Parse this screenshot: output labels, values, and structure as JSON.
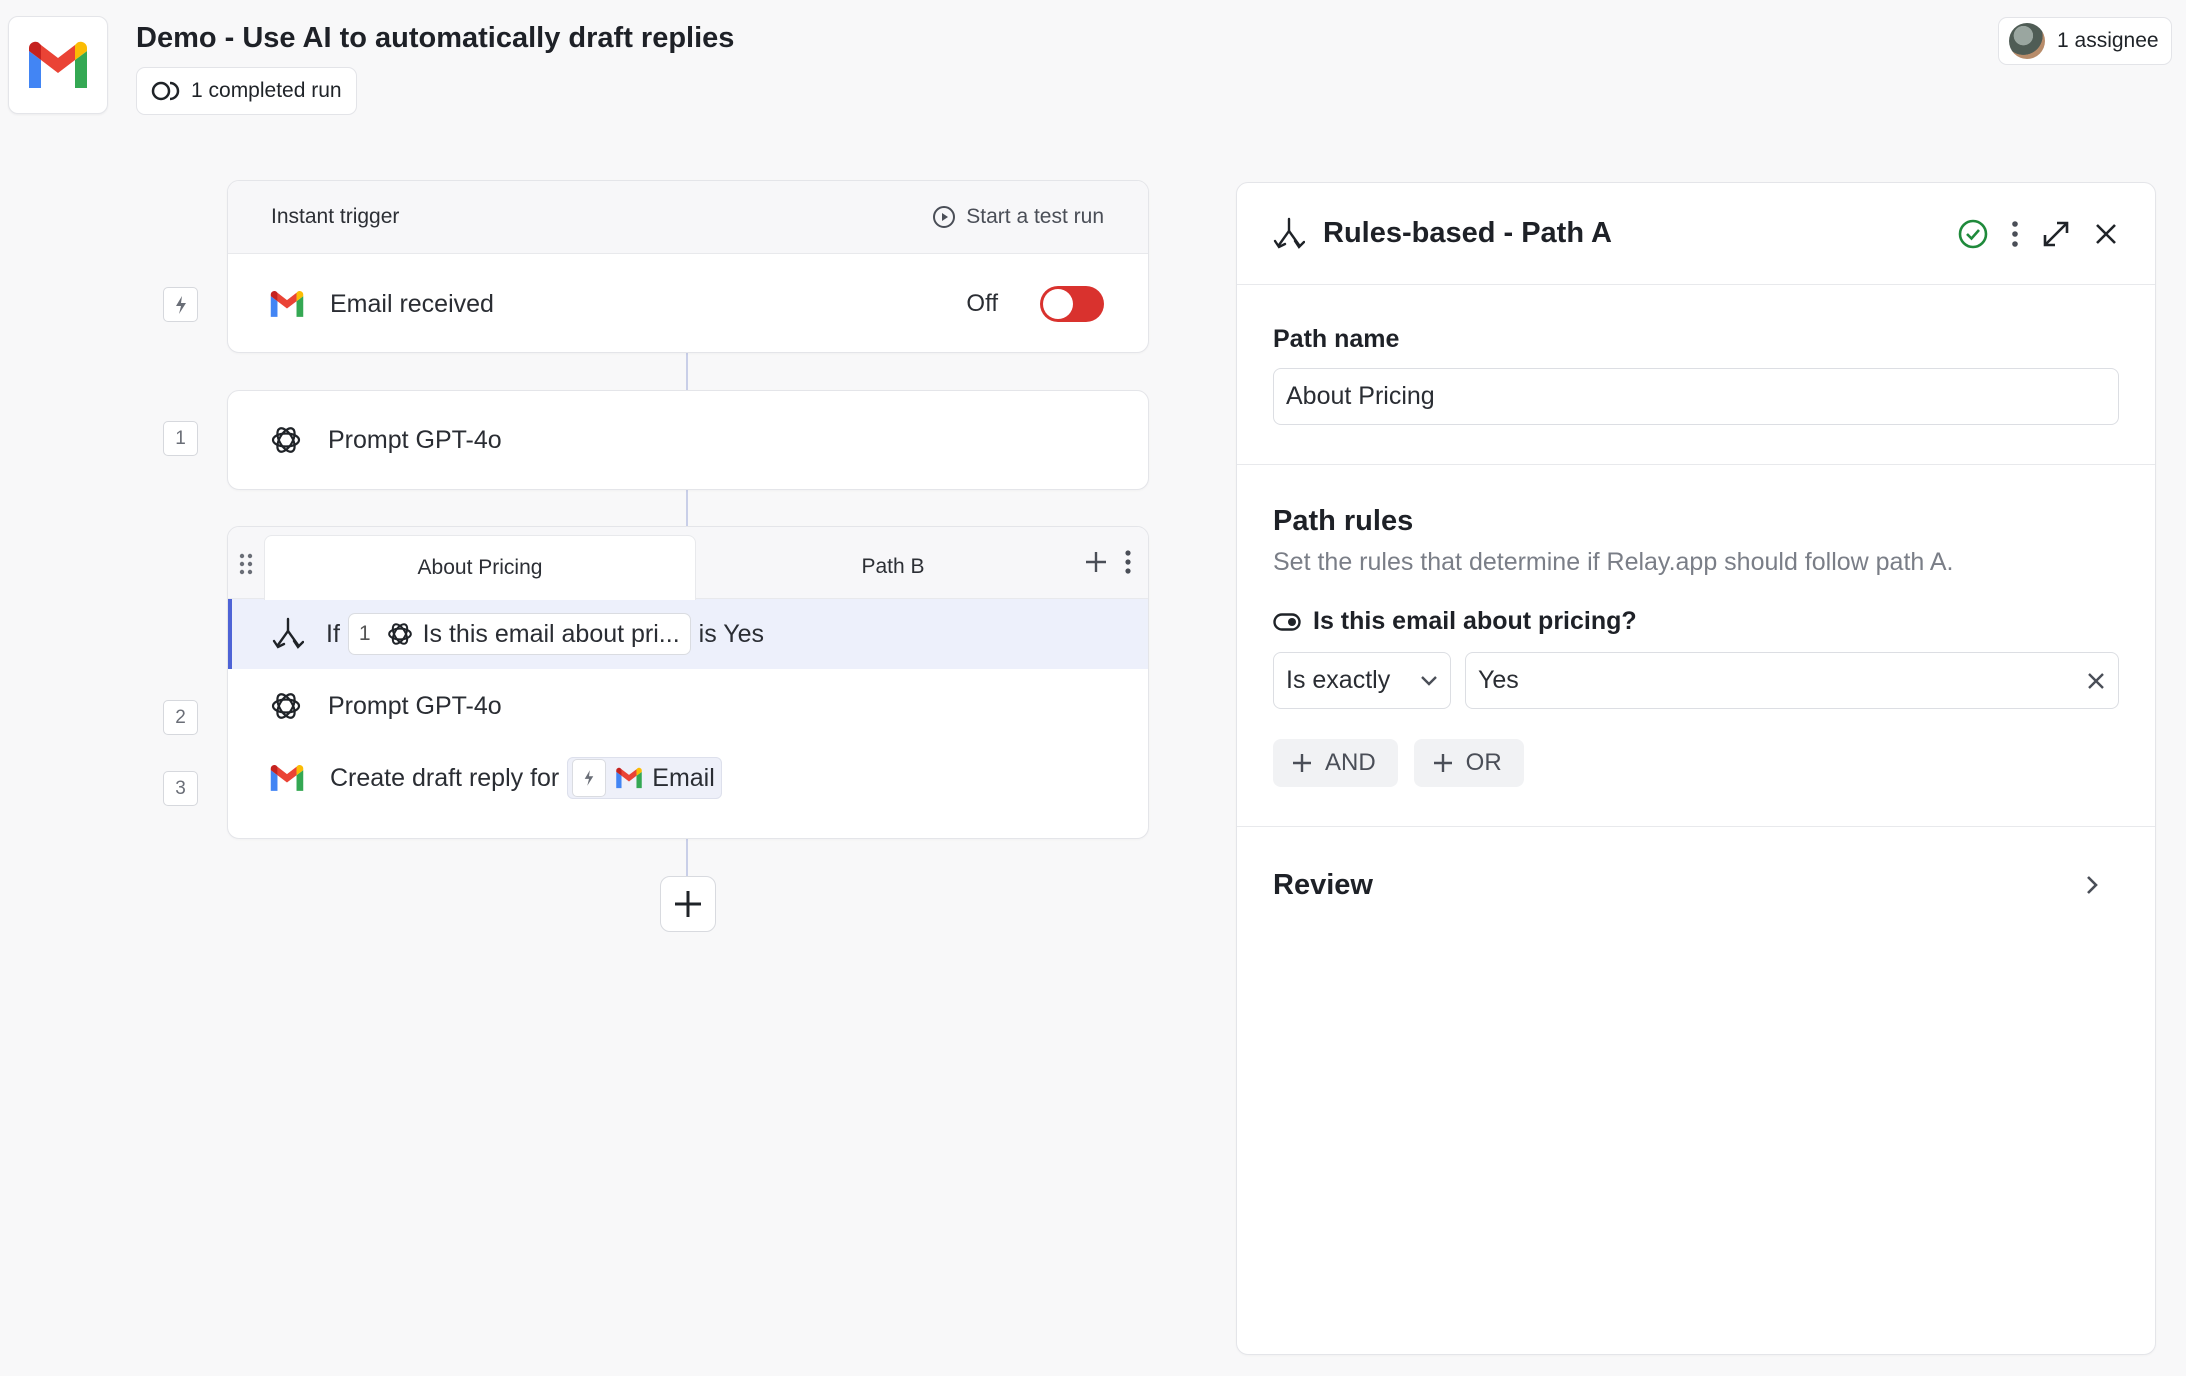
{
  "header": {
    "title": "Demo - Use AI to automatically draft replies",
    "runs_label": "1 completed run",
    "assignee_label": "1 assignee"
  },
  "trigger": {
    "header_label": "Instant trigger",
    "test_run_label": "Start a test run",
    "step_label": "Email received",
    "status_label": "Off",
    "enabled": false
  },
  "steps": {
    "step1": {
      "number": "1",
      "label": "Prompt GPT-4o"
    },
    "paths": {
      "tab_a": "About Pricing",
      "tab_b": "Path B",
      "condition": {
        "if_label": "If",
        "ref_number": "1",
        "ref_text": "Is this email about pri...",
        "suffix": "is Yes"
      }
    },
    "step2": {
      "number": "2",
      "label": "Prompt GPT-4o"
    },
    "step3": {
      "number": "3",
      "label": "Create draft reply for",
      "ref_label": "Email"
    }
  },
  "panel": {
    "title": "Rules-based - Path A",
    "path_name_label": "Path name",
    "path_name_value": "About Pricing",
    "rules_title": "Path rules",
    "rules_desc": "Set the rules that determine if Relay.app should follow path A.",
    "rule_field_label": "Is this email about pricing?",
    "operator": "Is exactly",
    "value": "Yes",
    "and_label": "AND",
    "or_label": "OR",
    "review_label": "Review"
  },
  "colors": {
    "accent": "#4e63d6",
    "toggle_off": "#d9322e",
    "success": "#1f8a3b"
  }
}
